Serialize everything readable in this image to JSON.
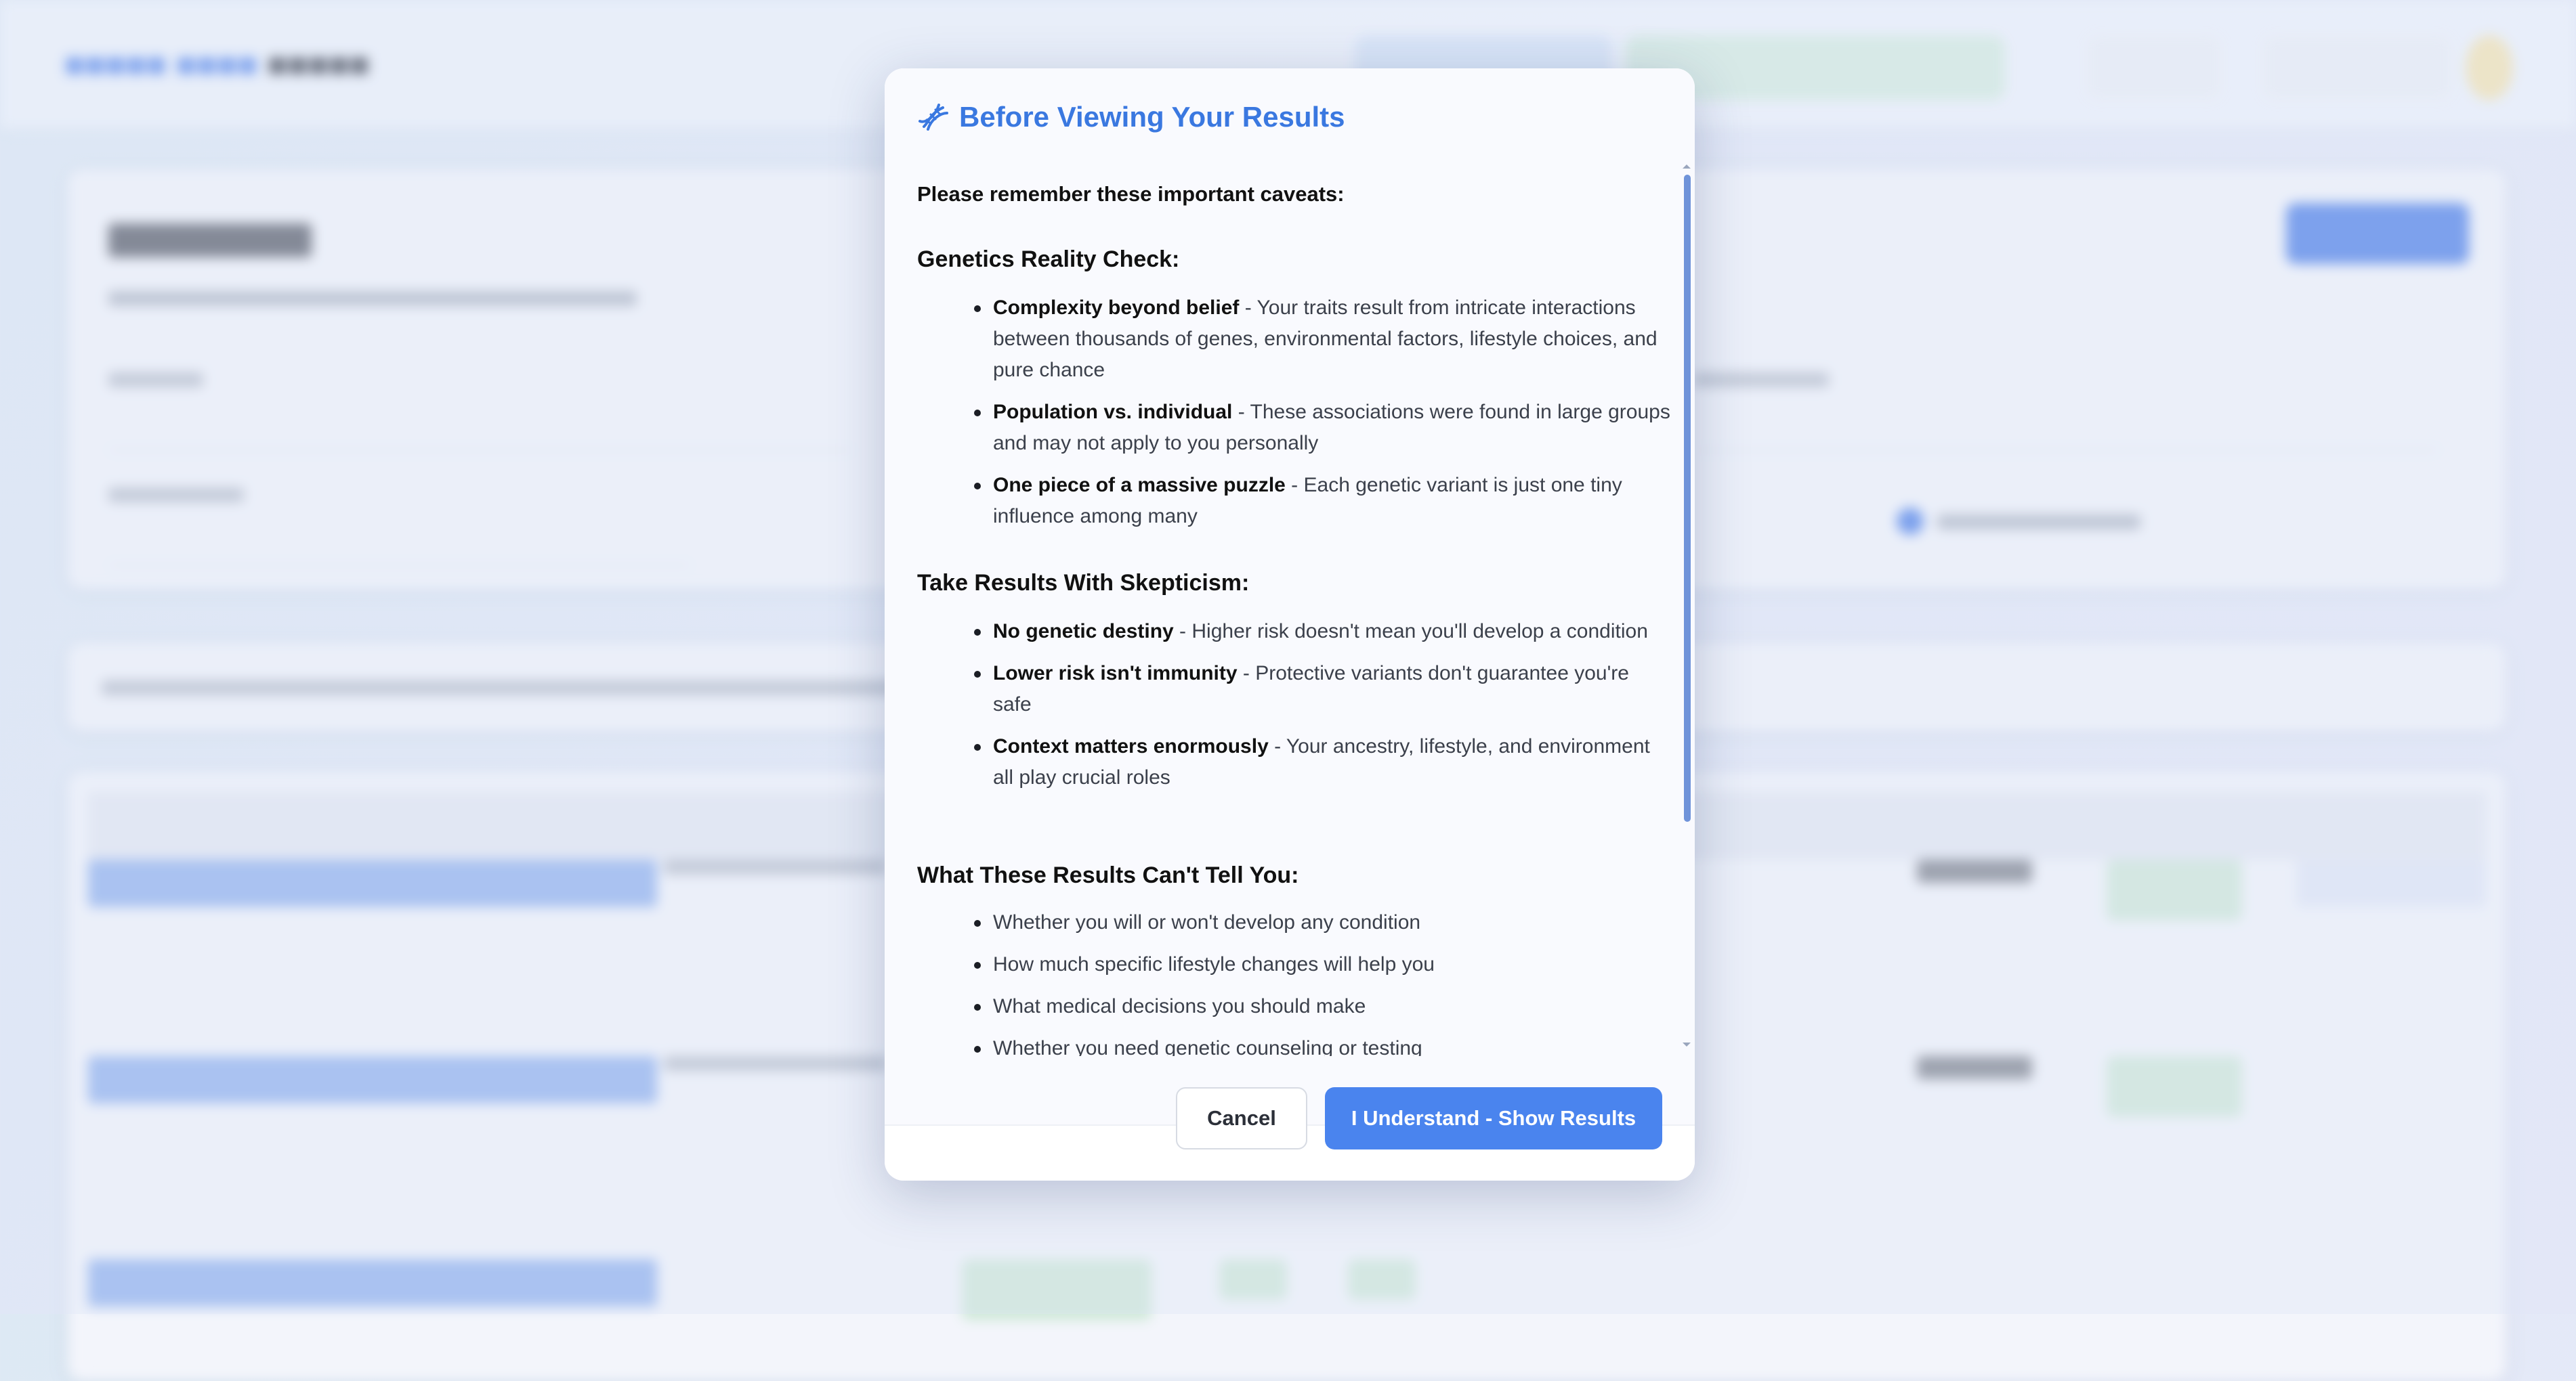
{
  "modal": {
    "title": "Before Viewing Your Results",
    "icon": "dna-icon",
    "intro": "Please remember these important caveats:",
    "sections": [
      {
        "title": "Genetics Reality Check:",
        "items": [
          {
            "strong": "Complexity beyond belief",
            "text": " - Your traits result from intricate interactions between thousands of genes, environmental factors, lifestyle choices, and pure chance"
          },
          {
            "strong": "Population vs. individual",
            "text": " - These associations were found in large groups and may not apply to you personally"
          },
          {
            "strong": "One piece of a massive puzzle",
            "text": " - Each genetic variant is just one tiny influence among many"
          }
        ]
      },
      {
        "title": "Take Results With Skepticism:",
        "items": [
          {
            "strong": "No genetic destiny",
            "text": " - Higher risk doesn't mean you'll develop a condition"
          },
          {
            "strong": "Lower risk isn't immunity",
            "text": " - Protective variants don't guarantee you're safe"
          },
          {
            "strong": "Context matters enormously",
            "text": " - Your ancestry, lifestyle, and environment all play crucial roles"
          }
        ]
      },
      {
        "title": "What These Results Can't Tell You:",
        "items": [
          {
            "text": "Whether you will or won't develop any condition"
          },
          {
            "text": "How much specific lifestyle changes will help you"
          },
          {
            "text": "What medical decisions you should make"
          },
          {
            "text": "Whether you need genetic counseling or testing"
          }
        ]
      }
    ],
    "cancel_label": "Cancel",
    "confirm_label": "I Understand - Show Results"
  },
  "colors": {
    "accent": "#4a84ee",
    "title": "#3a78e0",
    "scroll_thumb": "#6f93d9"
  }
}
